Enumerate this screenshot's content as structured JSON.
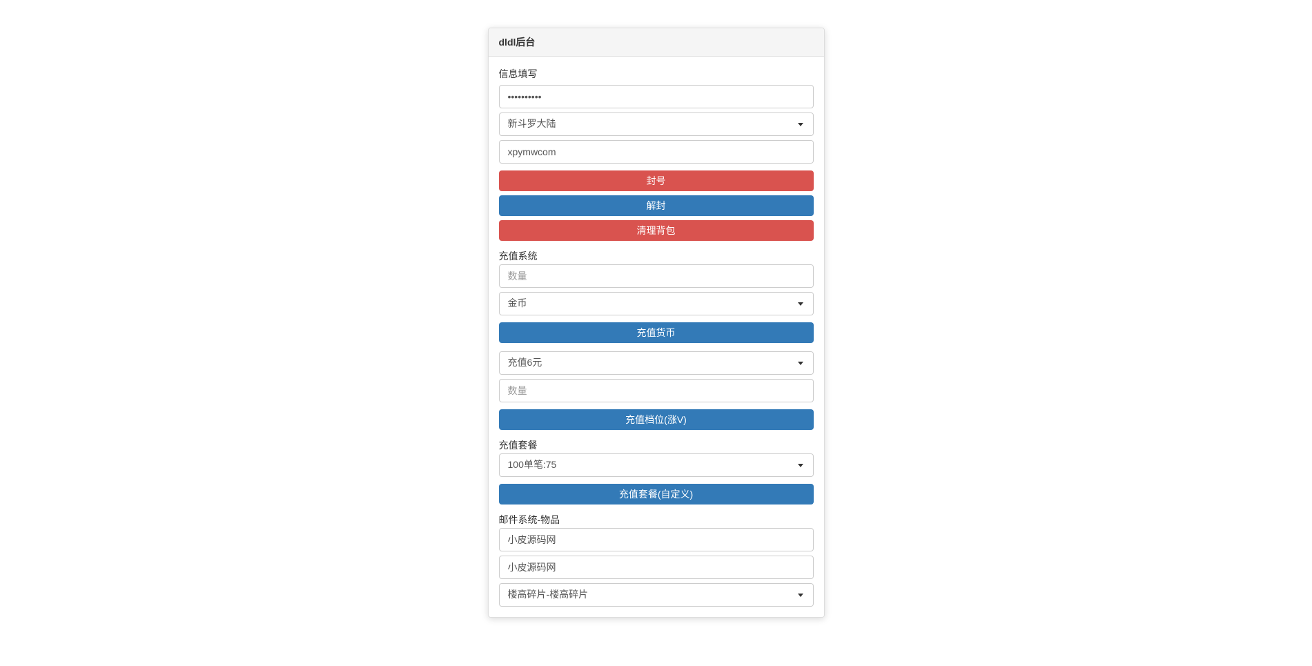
{
  "panel": {
    "title": "dldl后台"
  },
  "info": {
    "label": "信息填写",
    "password_value": "••••••••••",
    "game_select": "新斗罗大陆",
    "account_value": "xpymwcom"
  },
  "actions": {
    "ban": "封号",
    "unban": "解封",
    "clear_bag": "清理背包"
  },
  "recharge": {
    "label": "充值系统",
    "qty_placeholder": "数量",
    "currency_select": "金币",
    "charge_currency_btn": "充值货币",
    "tier_select": "充值6元",
    "tier_qty_placeholder": "数量",
    "charge_tier_btn": "充值档位(涨V)"
  },
  "package": {
    "label": "充值套餐",
    "select": "100单笔:75",
    "btn": "充值套餐(自定义)"
  },
  "mail": {
    "label": "邮件系统-物品",
    "val1": "小皮源码网",
    "val2": "小皮源码网",
    "item_select": "楼高碎片-楼高碎片"
  }
}
